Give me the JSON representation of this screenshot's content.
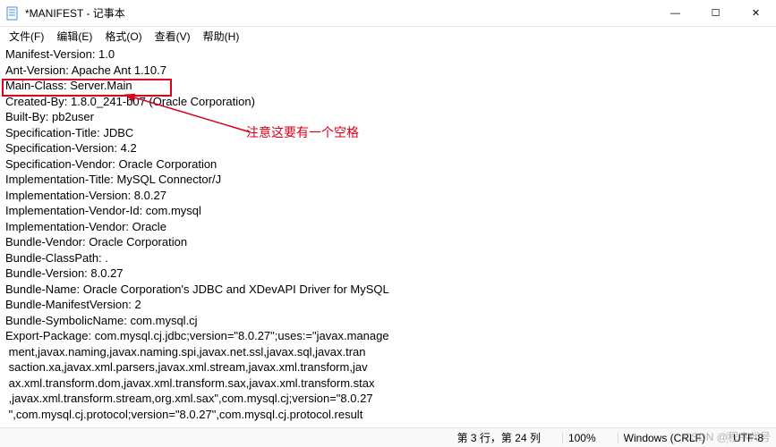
{
  "titlebar": {
    "icon_name": "notepad-icon",
    "title": "*MANIFEST - 记事本"
  },
  "window_buttons": {
    "minimize": "—",
    "maximize": "☐",
    "close": "✕"
  },
  "menu": {
    "file": "文件(F)",
    "edit": "编辑(E)",
    "format": "格式(O)",
    "view": "查看(V)",
    "help": "帮助(H)"
  },
  "content_lines": [
    "Manifest-Version: 1.0",
    "Ant-Version: Apache Ant 1.10.7",
    "Main-Class: Server.Main",
    "Created-By: 1.8.0_241-b07 (Oracle Corporation)",
    "Built-By: pb2user",
    "Specification-Title: JDBC",
    "Specification-Version: 4.2",
    "Specification-Vendor: Oracle Corporation",
    "Implementation-Title: MySQL Connector/J",
    "Implementation-Version: 8.0.27",
    "Implementation-Vendor-Id: com.mysql",
    "Implementation-Vendor: Oracle",
    "Bundle-Vendor: Oracle Corporation",
    "Bundle-ClassPath: .",
    "Bundle-Version: 8.0.27",
    "Bundle-Name: Oracle Corporation's JDBC and XDevAPI Driver for MySQL",
    "Bundle-ManifestVersion: 2",
    "Bundle-SymbolicName: com.mysql.cj",
    "Export-Package: com.mysql.cj.jdbc;version=\"8.0.27\";uses:=\"javax.manage",
    " ment,javax.naming,javax.naming.spi,javax.net.ssl,javax.sql,javax.tran",
    " saction.xa,javax.xml.parsers,javax.xml.stream,javax.xml.transform,jav",
    " ax.xml.transform.dom,javax.xml.transform.sax,javax.xml.transform.stax",
    " ,javax.xml.transform.stream,org.xml.sax\",com.mysql.cj;version=\"8.0.27",
    " \",com.mysql.cj.protocol;version=\"8.0.27\",com.mysql.cj.protocol.result"
  ],
  "annotation": {
    "text": "注意这要有一个空格"
  },
  "statusbar": {
    "position": "第 3 行，第 24 列",
    "zoom": "100%",
    "line_ending": "Windows (CRLF)",
    "encoding": "UTF-8"
  },
  "watermark": "CSDN @程序代号"
}
